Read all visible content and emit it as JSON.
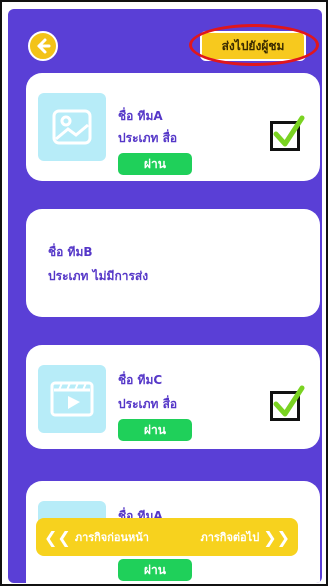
{
  "header": {
    "send_label": "ส่งไปยังผู้ชม"
  },
  "cards": [
    {
      "name": "ชื่อ ทีมA",
      "type": "ประเภท  สื่อ",
      "status": "ผ่าน",
      "checked": true,
      "thumb": "image-icon"
    },
    {
      "name": "ชื่อ ทีมB",
      "type": "ประเภท  ไม่มีการส่ง"
    },
    {
      "name": "ชื่อ ทีมC",
      "type": "ประเภท  สื่อ",
      "status": "ผ่าน",
      "checked": true,
      "thumb": "video-icon"
    },
    {
      "name": "ชื่อ ทีมA",
      "status": "ผ่าน"
    }
  ],
  "nav": {
    "prev_label": "ภารกิจก่อนหน้า",
    "next_label": "ภารกิจต่อไป"
  },
  "colors": {
    "background": "#5a3fd6",
    "accent": "#f7c91e",
    "pass_green": "#1fd05a",
    "highlight_ellipse": "#e0161c"
  }
}
